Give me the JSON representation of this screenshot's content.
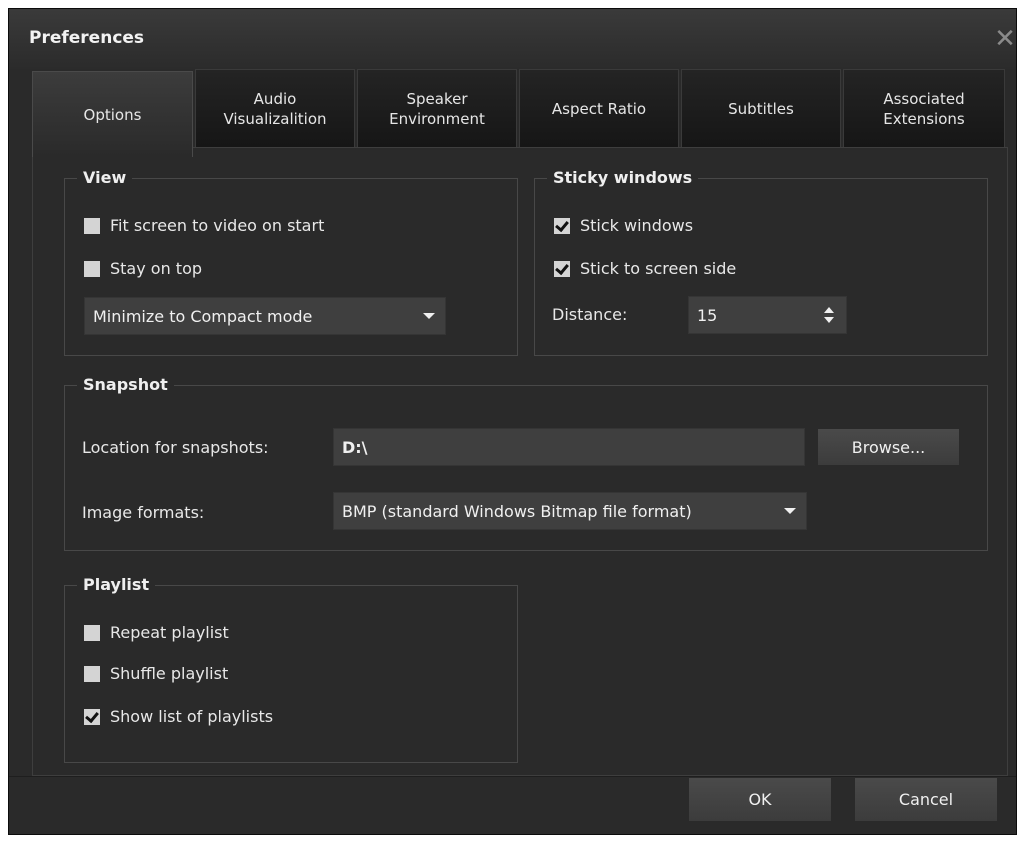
{
  "window": {
    "title": "Preferences",
    "close_glyph": "✕"
  },
  "tabs": [
    {
      "label": "Options",
      "active": true
    },
    {
      "label": "Audio\nVisualizalition",
      "active": false
    },
    {
      "label": "Speaker\nEnvironment",
      "active": false
    },
    {
      "label": "Aspect Ratio",
      "active": false
    },
    {
      "label": "Subtitles",
      "active": false
    },
    {
      "label": "Associated\nExtensions",
      "active": false
    }
  ],
  "view": {
    "title": "View",
    "fit_screen": {
      "label": "Fit screen to video on start",
      "checked": false
    },
    "stay_on_top": {
      "label": "Stay on top",
      "checked": false
    },
    "minimize_select": {
      "value": "Minimize to Compact mode"
    }
  },
  "sticky": {
    "title": "Sticky windows",
    "stick_windows": {
      "label": "Stick windows",
      "checked": true
    },
    "stick_screen_side": {
      "label": "Stick to screen side",
      "checked": true
    },
    "distance_label": "Distance:",
    "distance_value": "15"
  },
  "snapshot": {
    "title": "Snapshot",
    "location_label": "Location for snapshots:",
    "location_value": "D:\\",
    "browse_label": "Browse...",
    "formats_label": "Image formats:",
    "formats_value": "BMP (standard Windows Bitmap file format)"
  },
  "playlist": {
    "title": "Playlist",
    "repeat": {
      "label": "Repeat playlist",
      "checked": false
    },
    "shuffle": {
      "label": "Shuffle playlist",
      "checked": false
    },
    "show_list": {
      "label": "Show list of playlists",
      "checked": true
    }
  },
  "footer": {
    "ok_label": "OK",
    "cancel_label": "Cancel"
  },
  "colors": {
    "background": "#2a2a2a",
    "text": "#e8e8e8",
    "control": "#3f3f3f"
  }
}
